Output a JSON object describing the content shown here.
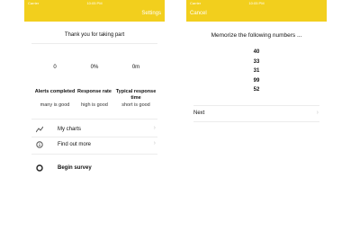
{
  "left": {
    "status": {
      "carrier": "Carrier",
      "time": "10:05 PM",
      "battery": ""
    },
    "nav": {
      "title": "",
      "right": "Settings"
    },
    "thanks": "Thank you for taking part",
    "stats": [
      {
        "value": "0",
        "label": "Alerts completed",
        "sub": "many is good"
      },
      {
        "value": "0%",
        "label": "Response rate",
        "sub": "high is good"
      },
      {
        "value": "0m",
        "label": "Typical response time",
        "sub": "short is good"
      }
    ],
    "menu": [
      {
        "label": "My charts",
        "icon": "chart-icon"
      },
      {
        "label": "Find out more",
        "icon": "info-icon"
      }
    ],
    "begin": {
      "label": "Begin survey",
      "icon": "circle-icon"
    }
  },
  "right": {
    "status": {
      "carrier": "Carrier",
      "time": "10:05 PM",
      "battery": ""
    },
    "nav": {
      "left": "Cancel"
    },
    "title": "Memorize the following numbers ...",
    "numbers": [
      "40",
      "33",
      "31",
      "99",
      "52"
    ],
    "next": "Next"
  }
}
